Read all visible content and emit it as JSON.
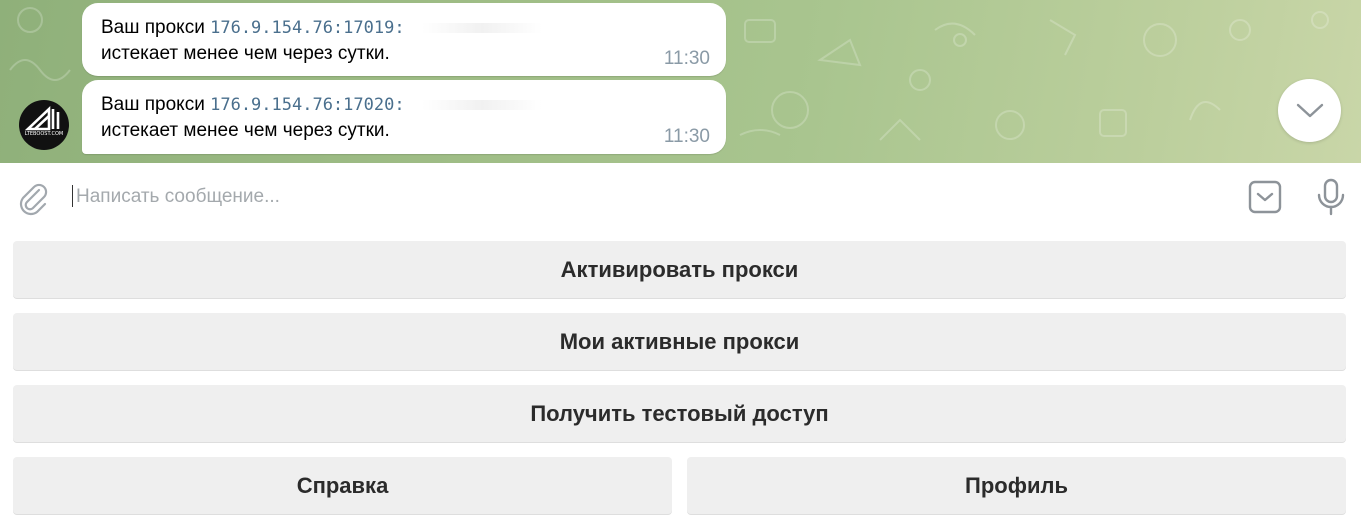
{
  "messages": [
    {
      "prefix": "Ваш прокси",
      "proxy": "176.9.154.76:17019:",
      "text": "истекает менее чем через сутки.",
      "time": "11:30"
    },
    {
      "prefix": "Ваш прокси",
      "proxy": "176.9.154.76:17020:",
      "text": "истекает менее чем через сутки.",
      "time": "11:30"
    }
  ],
  "avatar": {
    "caption": "LTEBOOST.COM"
  },
  "composer": {
    "placeholder": "Написать сообщение...",
    "value": ""
  },
  "keyboard": {
    "rows": [
      [
        "Активировать прокси"
      ],
      [
        "Мои активные прокси"
      ],
      [
        "Получить тестовый доступ"
      ],
      [
        "Справка",
        "Профиль"
      ]
    ]
  },
  "colors": {
    "accent": "#4a6f8d",
    "chat_bg": "#a9c58f",
    "button_bg": "#efefef"
  },
  "icons": {
    "attach": "paperclip-icon",
    "keyboard_toggle": "bot-keyboard-icon",
    "mic": "microphone-icon",
    "scroll": "chevron-down-icon"
  }
}
